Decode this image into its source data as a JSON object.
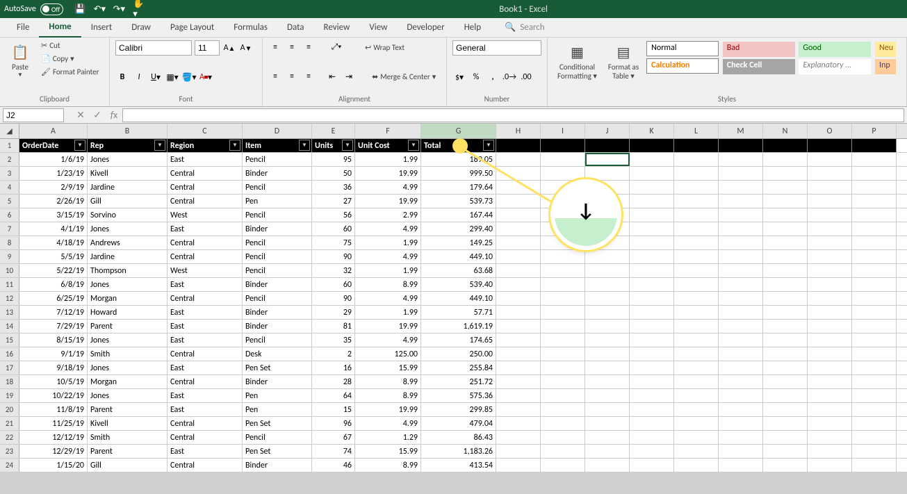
{
  "titlebar": {
    "autosave_label": "AutoSave",
    "autosave_state": "Off",
    "title": "Book1 - Excel"
  },
  "tabs": [
    "File",
    "Home",
    "Insert",
    "Draw",
    "Page Layout",
    "Formulas",
    "Data",
    "Review",
    "View",
    "Developer",
    "Help"
  ],
  "search_label": "Search",
  "ribbon": {
    "paste_label": "Paste",
    "cut_label": "Cut",
    "copy_label": "Copy",
    "format_painter_label": "Format Painter",
    "clipboard_group": "Clipboard",
    "font_name": "Calibri",
    "font_size": "11",
    "font_group": "Font",
    "wrap_text_label": "Wrap Text",
    "merge_label": "Merge & Center",
    "alignment_group": "Alignment",
    "number_format": "General",
    "number_group": "Number",
    "cond_fmt_label": "Conditional",
    "cond_fmt_label2": "Formatting",
    "fmt_table_label": "Format as",
    "fmt_table_label2": "Table",
    "styles_group": "Styles",
    "style_normal": "Normal",
    "style_bad": "Bad",
    "style_good": "Good",
    "style_neutral": "Neu",
    "style_calc": "Calculation",
    "style_check": "Check Cell",
    "style_expl": "Explanatory ...",
    "style_input": "Inp"
  },
  "name_box": "J2",
  "columns": [
    "A",
    "B",
    "C",
    "D",
    "E",
    "F",
    "G",
    "H",
    "I",
    "J",
    "K",
    "L",
    "M",
    "N",
    "O",
    "P"
  ],
  "headers": [
    "OrderDate",
    "Rep",
    "Region",
    "Item",
    "Units",
    "Unit Cost",
    "Total"
  ],
  "rows": [
    {
      "date": "1/6/19",
      "rep": "Jones",
      "region": "East",
      "item": "Pencil",
      "units": "95",
      "cost": "1.99",
      "total": "189.05"
    },
    {
      "date": "1/23/19",
      "rep": "Kivell",
      "region": "Central",
      "item": "Binder",
      "units": "50",
      "cost": "19.99",
      "total": "999.50"
    },
    {
      "date": "2/9/19",
      "rep": "Jardine",
      "region": "Central",
      "item": "Pencil",
      "units": "36",
      "cost": "4.99",
      "total": "179.64"
    },
    {
      "date": "2/26/19",
      "rep": "Gill",
      "region": "Central",
      "item": "Pen",
      "units": "27",
      "cost": "19.99",
      "total": "539.73"
    },
    {
      "date": "3/15/19",
      "rep": "Sorvino",
      "region": "West",
      "item": "Pencil",
      "units": "56",
      "cost": "2.99",
      "total": "167.44"
    },
    {
      "date": "4/1/19",
      "rep": "Jones",
      "region": "East",
      "item": "Binder",
      "units": "60",
      "cost": "4.99",
      "total": "299.40"
    },
    {
      "date": "4/18/19",
      "rep": "Andrews",
      "region": "Central",
      "item": "Pencil",
      "units": "75",
      "cost": "1.99",
      "total": "149.25"
    },
    {
      "date": "5/5/19",
      "rep": "Jardine",
      "region": "Central",
      "item": "Pencil",
      "units": "90",
      "cost": "4.99",
      "total": "449.10"
    },
    {
      "date": "5/22/19",
      "rep": "Thompson",
      "region": "West",
      "item": "Pencil",
      "units": "32",
      "cost": "1.99",
      "total": "63.68"
    },
    {
      "date": "6/8/19",
      "rep": "Jones",
      "region": "East",
      "item": "Binder",
      "units": "60",
      "cost": "8.99",
      "total": "539.40"
    },
    {
      "date": "6/25/19",
      "rep": "Morgan",
      "region": "Central",
      "item": "Pencil",
      "units": "90",
      "cost": "4.99",
      "total": "449.10"
    },
    {
      "date": "7/12/19",
      "rep": "Howard",
      "region": "East",
      "item": "Binder",
      "units": "29",
      "cost": "1.99",
      "total": "57.71"
    },
    {
      "date": "7/29/19",
      "rep": "Parent",
      "region": "East",
      "item": "Binder",
      "units": "81",
      "cost": "19.99",
      "total": "1,619.19"
    },
    {
      "date": "8/15/19",
      "rep": "Jones",
      "region": "East",
      "item": "Pencil",
      "units": "35",
      "cost": "4.99",
      "total": "174.65"
    },
    {
      "date": "9/1/19",
      "rep": "Smith",
      "region": "Central",
      "item": "Desk",
      "units": "2",
      "cost": "125.00",
      "total": "250.00"
    },
    {
      "date": "9/18/19",
      "rep": "Jones",
      "region": "East",
      "item": "Pen Set",
      "units": "16",
      "cost": "15.99",
      "total": "255.84"
    },
    {
      "date": "10/5/19",
      "rep": "Morgan",
      "region": "Central",
      "item": "Binder",
      "units": "28",
      "cost": "8.99",
      "total": "251.72"
    },
    {
      "date": "10/22/19",
      "rep": "Jones",
      "region": "East",
      "item": "Pen",
      "units": "64",
      "cost": "8.99",
      "total": "575.36"
    },
    {
      "date": "11/8/19",
      "rep": "Parent",
      "region": "East",
      "item": "Pen",
      "units": "15",
      "cost": "19.99",
      "total": "299.85"
    },
    {
      "date": "11/25/19",
      "rep": "Kivell",
      "region": "Central",
      "item": "Pen Set",
      "units": "96",
      "cost": "4.99",
      "total": "479.04"
    },
    {
      "date": "12/12/19",
      "rep": "Smith",
      "region": "Central",
      "item": "Pencil",
      "units": "67",
      "cost": "1.29",
      "total": "86.43"
    },
    {
      "date": "12/29/19",
      "rep": "Parent",
      "region": "East",
      "item": "Pen Set",
      "units": "74",
      "cost": "15.99",
      "total": "1,183.26"
    },
    {
      "date": "1/15/20",
      "rep": "Gill",
      "region": "Central",
      "item": "Binder",
      "units": "46",
      "cost": "8.99",
      "total": "413.54"
    }
  ]
}
